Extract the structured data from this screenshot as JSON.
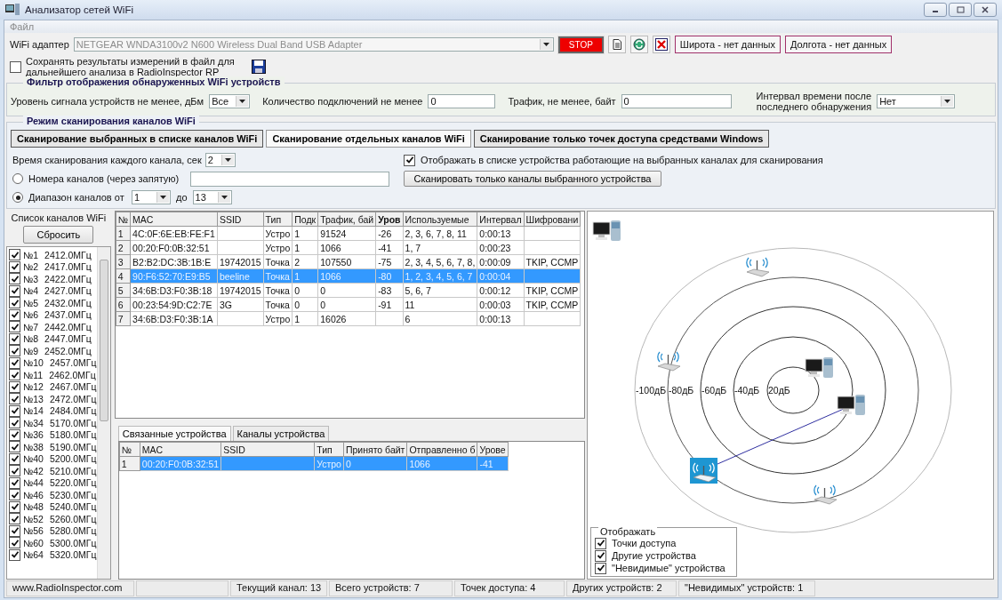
{
  "window": {
    "title": "Анализатор сетей WiFi"
  },
  "menu": [
    "Файл"
  ],
  "adapter": {
    "label": "WiFi адаптер",
    "value": "NETGEAR WNDA3100v2 N600 Wireless Dual Band USB Adapter",
    "disabled": true,
    "stop_button": "STOP",
    "latitude": "Широта - нет данных",
    "longitude": "Долгота - нет данных"
  },
  "save_results": {
    "checked": false,
    "label_lines": [
      "Сохранять результаты измерений в файл для",
      "дальнейшего анализа в RadioInspector RP"
    ]
  },
  "filter": {
    "title": "Фильтр отображения обнаруженных WiFi устройств",
    "signal_label": "Уровень сигнала устройств не менее, дБм",
    "signal_value": "Все",
    "connections_label": "Количество подключений не менее",
    "connections_value": "0",
    "traffic_label": "Трафик, не менее, байт",
    "traffic_value": "0",
    "interval_label_lines": [
      "Интервал времени после",
      "последнего обнаружения"
    ],
    "interval_value": "Нет"
  },
  "scan_mode": {
    "title": "Режим сканирования каналов WiFi",
    "tabs": [
      {
        "label": "Сканирование выбранных в списке каналов WiFi",
        "selected": false
      },
      {
        "label": "Сканирование отдельных каналов  WiFi",
        "selected": true
      },
      {
        "label": "Сканирование только точек доступа средствами Windows",
        "selected": false
      }
    ],
    "scan_time_label": "Время сканирования каждого канала, сек",
    "scan_time_value": "2",
    "channel_numbers": {
      "label": "Номера каналов (через запятую)",
      "selected": false
    },
    "channel_range": {
      "label": "Диапазон каналов от",
      "selected": true,
      "from": "1",
      "to_label": "до",
      "to": "13"
    },
    "show_option": {
      "checked": true,
      "label": "Отображать в списке устройства работающие на выбранных каналах для сканирования"
    },
    "scan_device_button": "Сканировать только каналы выбранного устройства"
  },
  "channel_list": {
    "title": "Список каналов WiFi",
    "reset_button": "Сбросить",
    "channels": [
      {
        "number": "№1",
        "frequency": "2412.0МГц",
        "checked": true
      },
      {
        "number": "№2",
        "frequency": "2417.0МГц",
        "checked": true
      },
      {
        "number": "№3",
        "frequency": "2422.0МГц",
        "checked": true
      },
      {
        "number": "№4",
        "frequency": "2427.0МГц",
        "checked": true
      },
      {
        "number": "№5",
        "frequency": "2432.0МГц",
        "checked": true
      },
      {
        "number": "№6",
        "frequency": "2437.0МГц",
        "checked": true
      },
      {
        "number": "№7",
        "frequency": "2442.0МГц",
        "checked": true
      },
      {
        "number": "№8",
        "frequency": "2447.0МГц",
        "checked": true
      },
      {
        "number": "№9",
        "frequency": "2452.0МГц",
        "checked": true
      },
      {
        "number": "№10",
        "frequency": "2457.0МГц",
        "checked": true
      },
      {
        "number": "№11",
        "frequency": "2462.0МГц",
        "checked": true
      },
      {
        "number": "№12",
        "frequency": "2467.0МГц",
        "checked": true
      },
      {
        "number": "№13",
        "frequency": "2472.0МГц",
        "checked": true
      },
      {
        "number": "№14",
        "frequency": "2484.0МГц",
        "checked": true
      },
      {
        "number": "№34",
        "frequency": "5170.0МГц",
        "checked": true
      },
      {
        "number": "№36",
        "frequency": "5180.0МГц",
        "checked": true
      },
      {
        "number": "№38",
        "frequency": "5190.0МГц",
        "checked": true
      },
      {
        "number": "№40",
        "frequency": "5200.0МГц",
        "checked": true
      },
      {
        "number": "№42",
        "frequency": "5210.0МГц",
        "checked": true
      },
      {
        "number": "№44",
        "frequency": "5220.0МГц",
        "checked": true
      },
      {
        "number": "№46",
        "frequency": "5230.0МГц",
        "checked": true
      },
      {
        "number": "№48",
        "frequency": "5240.0МГц",
        "checked": true
      },
      {
        "number": "№52",
        "frequency": "5260.0МГц",
        "checked": true
      },
      {
        "number": "№56",
        "frequency": "5280.0МГц",
        "checked": true
      },
      {
        "number": "№60",
        "frequency": "5300.0МГц",
        "checked": true
      },
      {
        "number": "№64",
        "frequency": "5320.0МГц",
        "checked": true
      }
    ]
  },
  "devices_table": {
    "columns": [
      {
        "label": "№",
        "sorted": false
      },
      {
        "label": "MAC",
        "sorted": false
      },
      {
        "label": "SSID",
        "sorted": false
      },
      {
        "label": "Тип",
        "sorted": false
      },
      {
        "label": "Подк",
        "sorted": false
      },
      {
        "label": "Трафик, бай",
        "sorted": false
      },
      {
        "label": "Уров",
        "sorted": true
      },
      {
        "label": "Используемые",
        "sorted": false
      },
      {
        "label": "Интервал",
        "sorted": false
      },
      {
        "label": "Шифровани",
        "sorted": false
      }
    ],
    "rows": [
      {
        "cells": [
          "1",
          "4C:0F:6E:EB:FE:F1",
          "",
          "Устро",
          "1",
          "91524",
          "-26",
          "2, 3, 6, 7, 8, 11",
          "0:00:13",
          ""
        ],
        "selected": false
      },
      {
        "cells": [
          "2",
          "00:20:F0:0B:32:51",
          "",
          "Устро",
          "1",
          "1066",
          "-41",
          "1, 7",
          "0:00:23",
          ""
        ],
        "selected": false
      },
      {
        "cells": [
          "3",
          "B2:B2:DC:3B:1B:E",
          "19742015",
          "Точка",
          "2",
          "107550",
          "-75",
          "2, 3, 4, 5, 6, 7, 8,",
          "0:00:09",
          "TKIP, CCMP"
        ],
        "selected": false
      },
      {
        "cells": [
          "4",
          "90:F6:52:70:E9:B5",
          "beeline",
          "Точка",
          "1",
          "1066",
          "-80",
          "1, 2, 3, 4, 5, 6, 7",
          "0:00:04",
          ""
        ],
        "selected": true
      },
      {
        "cells": [
          "5",
          "34:6B:D3:F0:3B:18",
          "19742015",
          "Точка",
          "0",
          "0",
          "-83",
          "5, 6, 7",
          "0:00:12",
          "TKIP, CCMP"
        ],
        "selected": false
      },
      {
        "cells": [
          "6",
          "00:23:54:9D:C2:7E",
          "3G",
          "Точка",
          "0",
          "0",
          "-91",
          "11",
          "0:00:03",
          "TKIP, CCMP"
        ],
        "selected": false
      },
      {
        "cells": [
          "7",
          "34:6B:D3:F0:3B:1A",
          "",
          "Устро",
          "1",
          "16026",
          "",
          "6",
          "0:00:13",
          ""
        ],
        "selected": false
      }
    ]
  },
  "detail_tabs": [
    {
      "label": "Связанные устройства",
      "selected": true
    },
    {
      "label": "Каналы устройства",
      "selected": false
    }
  ],
  "linked_table": {
    "columns": [
      "№",
      "MAC",
      "SSID",
      "Тип",
      "Принято байт",
      "Отправленно б",
      "Урове"
    ],
    "rows": [
      {
        "cells": [
          "1",
          "00:20:F0:0B:32:51",
          "",
          "Устро",
          "0",
          "1066",
          "-41"
        ],
        "selected": true
      }
    ]
  },
  "radar": {
    "ring_labels": [
      "-100дБ",
      "-80дБ",
      "-60дБ",
      "-40дБ",
      "20дБ"
    ],
    "devices": [
      {
        "kind": "pc",
        "selected": false,
        "linked": false
      },
      {
        "kind": "router",
        "selected": false,
        "linked": false
      },
      {
        "kind": "router",
        "selected": false,
        "linked": false
      },
      {
        "kind": "pc",
        "selected": false,
        "linked": false
      },
      {
        "kind": "pc",
        "selected": false,
        "linked": true
      },
      {
        "kind": "router",
        "selected": true,
        "linked": false
      },
      {
        "kind": "router",
        "selected": false,
        "linked": false
      }
    ],
    "legend": {
      "title": "Отображать",
      "items": [
        {
          "label": "Точки доступа",
          "checked": true
        },
        {
          "label": "Другие устройства",
          "checked": true
        },
        {
          "label": "\"Невидимые\" устройства",
          "checked": true
        }
      ]
    }
  },
  "status_bar": [
    "www.RadioInspector.com",
    "Текущий канал: 13",
    "Всего устройств: 7",
    "Точек доступа: 4",
    "Других устройств: 2",
    "\"Невидимых\" устройств: 1"
  ]
}
